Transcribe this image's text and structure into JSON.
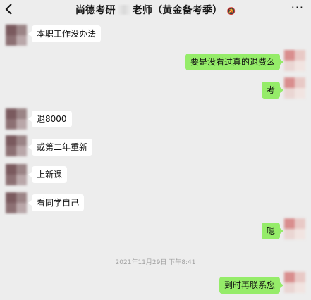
{
  "header": {
    "title_part1": "尚德考研",
    "title_part2": "老师（黄金备考季）",
    "more_label": "···"
  },
  "timestamp": "2021年11月29日 下午8:41",
  "messages": [
    {
      "side": "left",
      "text": "本职工作没办法"
    },
    {
      "side": "right",
      "text": "要是没看过真的退费么"
    },
    {
      "side": "right",
      "text": "考"
    },
    {
      "side": "left",
      "text": "退8000"
    },
    {
      "side": "left",
      "text": "或第二年重新"
    },
    {
      "side": "left",
      "text": "上新课"
    },
    {
      "side": "left",
      "text": "看同学自己"
    },
    {
      "side": "right",
      "text": "嗯"
    },
    {
      "side": "right",
      "text": "到时再联系您"
    }
  ],
  "colors": {
    "background": "#ededed",
    "bubble_self": "#95ec69",
    "bubble_other": "#ffffff"
  }
}
